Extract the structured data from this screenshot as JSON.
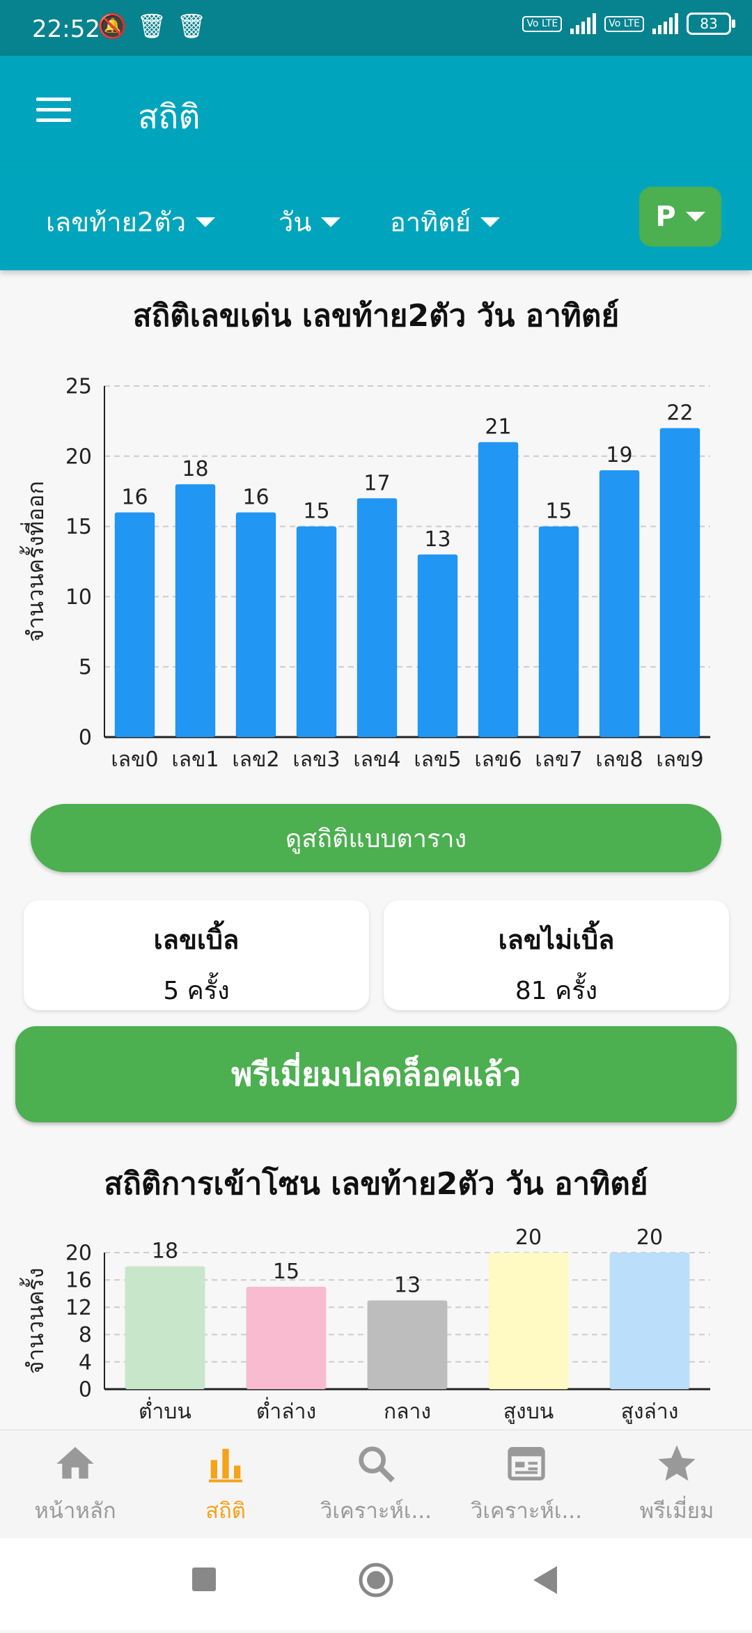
{
  "status_bar": {
    "time": "22:52",
    "battery": "83",
    "volte": "Vo LTE"
  },
  "app_bar": {
    "title": "สถิติ"
  },
  "filters": [
    {
      "label": "เลขท้าย2ตัว"
    },
    {
      "label": "วัน"
    },
    {
      "label": "อาทิตย์"
    }
  ],
  "profile_button": {
    "label": "P"
  },
  "chart1_title": "สถิติเลขเด่น เลขท้าย2ตัว วัน อาทิตย์",
  "table_button": {
    "label": "ดูสถิติแบบตาราง"
  },
  "cards": [
    {
      "title": "เลขเบิ้ล",
      "value": "5 ครั้ง"
    },
    {
      "title": "เลขไม่เบิ้ล",
      "value": "81 ครั้ง"
    }
  ],
  "premium_button": {
    "label": "พรีเมี่ยมปลดล็อคแล้ว"
  },
  "chart2_title": "สถิติการเข้าโซน เลขท้าย2ตัว วัน อาทิตย์",
  "bottom_nav": [
    {
      "label": "หน้าหลัก",
      "icon": "home-icon"
    },
    {
      "label": "สถิติ",
      "icon": "bar-chart-icon",
      "active": true
    },
    {
      "label": "วิเคราะห์เ...",
      "icon": "search-icon"
    },
    {
      "label": "วิเคราะห์เ...",
      "icon": "calendar-icon"
    },
    {
      "label": "พรีเมี่ยม",
      "icon": "star-icon"
    }
  ],
  "colors": {
    "bar": "#2196f3",
    "accent": "#4caf50",
    "header": "#00a5bd",
    "active_nav": "#f5a31a"
  },
  "chart_data": [
    {
      "type": "bar",
      "title": "สถิติเลขเด่น เลขท้าย2ตัว วัน อาทิตย์",
      "categories": [
        "เลข0",
        "เลข1",
        "เลข2",
        "เลข3",
        "เลข4",
        "เลข5",
        "เลข6",
        "เลข7",
        "เลข8",
        "เลข9"
      ],
      "values": [
        16,
        18,
        16,
        15,
        17,
        13,
        21,
        15,
        19,
        22
      ],
      "xlabel": "",
      "ylabel": "จำนวนครั้งที่ออก",
      "ylim": [
        0,
        25
      ],
      "yticks": [
        0,
        5,
        10,
        15,
        20,
        25
      ],
      "grid": true,
      "bar_color": "#2196f3"
    },
    {
      "type": "bar",
      "title": "สถิติการเข้าโซน เลขท้าย2ตัว วัน อาทิตย์",
      "categories": [
        "ต่ำบน",
        "ต่ำล่าง",
        "กลาง",
        "สูงบน",
        "สูงล่าง"
      ],
      "values": [
        18,
        15,
        13,
        20,
        20
      ],
      "xlabel": "",
      "ylabel": "จำนวนครั้ง",
      "ylim": [
        0,
        20
      ],
      "yticks": [
        0,
        4,
        8,
        12,
        16,
        20
      ],
      "grid": true,
      "bar_colors": [
        "#c8e6c9",
        "#f8bbd0",
        "#bdbdbd",
        "#fff9c4",
        "#bbdefb"
      ]
    }
  ]
}
